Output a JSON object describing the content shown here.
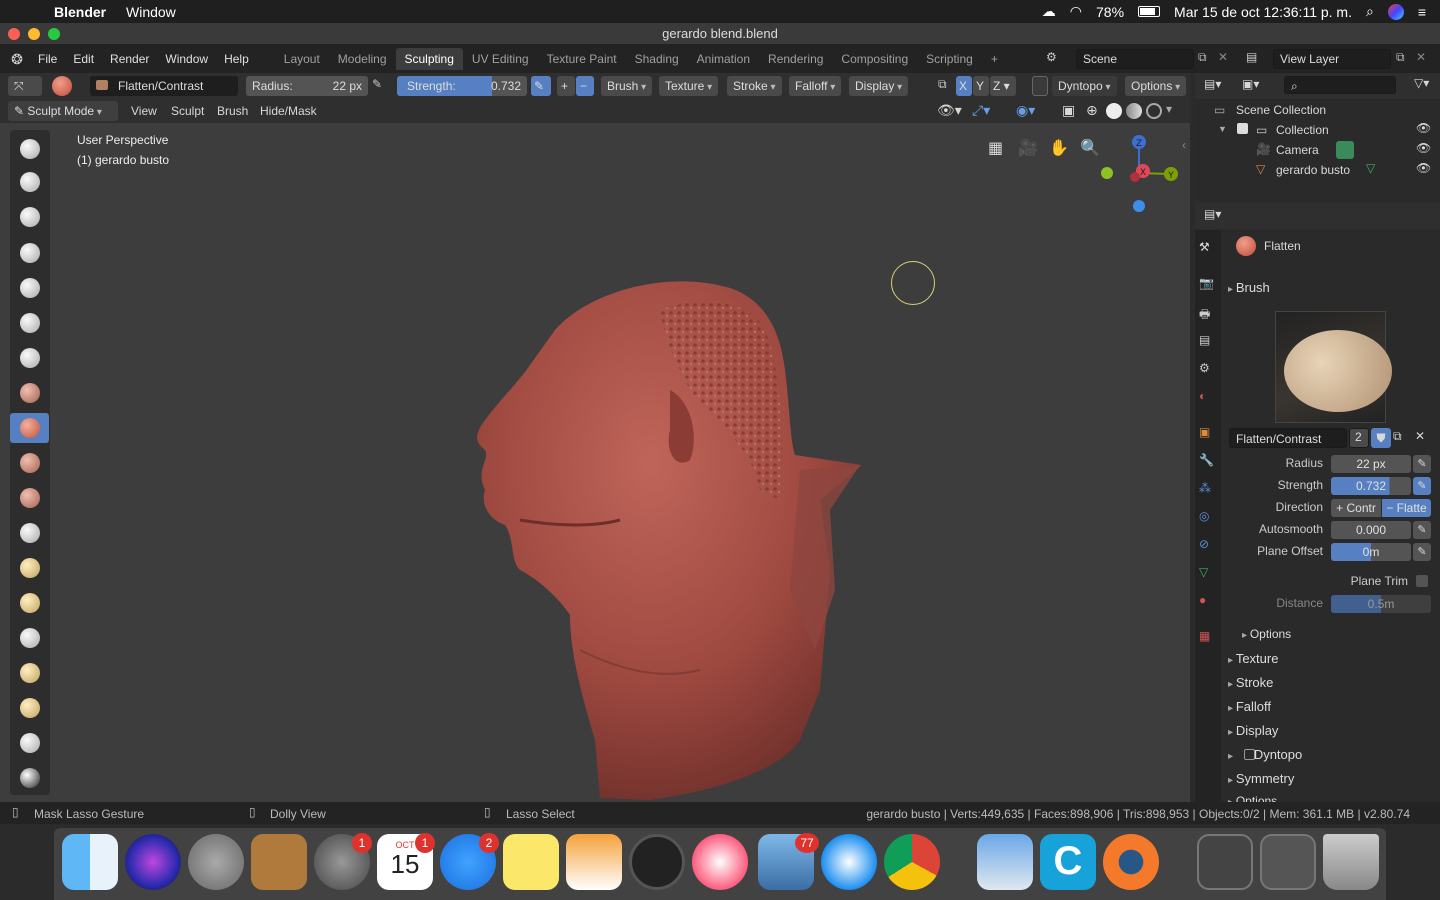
{
  "macbar": {
    "app": "Blender",
    "menu_window": "Window",
    "battery": "78%",
    "datetime": "Mar 15 de oct  12:36:11 p. m."
  },
  "window": {
    "title": "gerardo blend.blend"
  },
  "menu": [
    "File",
    "Edit",
    "Render",
    "Window",
    "Help"
  ],
  "workspaces": [
    "Layout",
    "Modeling",
    "Sculpting",
    "UV Editing",
    "Texture Paint",
    "Shading",
    "Animation",
    "Rendering",
    "Compositing",
    "Scripting"
  ],
  "scene": {
    "label": "Scene",
    "view_layer": "View Layer"
  },
  "tool_header": {
    "brush_name": "Flatten/Contrast",
    "radius_label": "Radius:",
    "radius_value": "22 px",
    "strength_label": "Strength:",
    "strength_value": "0.732",
    "plus": "+",
    "minus": "−",
    "brush": "Brush",
    "texture": "Texture",
    "stroke": "Stroke",
    "falloff": "Falloff",
    "display": "Display",
    "x": "X",
    "y": "Y",
    "z": "Z",
    "dyntopo": "Dyntopo",
    "options": "Options"
  },
  "mode_header": {
    "mode": "Sculpt Mode",
    "view": "View",
    "sculpt": "Sculpt",
    "brush": "Brush",
    "hide_mask": "Hide/Mask"
  },
  "viewport": {
    "perspective": "User Perspective",
    "object": "(1) gerardo busto"
  },
  "gizmo": {
    "z": "Z",
    "x": "X",
    "y": "Y"
  },
  "outliner": {
    "root": "Scene Collection",
    "collection": "Collection",
    "camera": "Camera",
    "object": "gerardo busto"
  },
  "properties": {
    "brush_title": "Flatten",
    "brush_section": "Brush",
    "brush_name": "Flatten/Contrast",
    "brush_users": "2",
    "radius_label": "Radius",
    "radius": "22 px",
    "strength_label": "Strength",
    "strength": "0.732",
    "direction_label": "Direction",
    "dir_contrast": "+ Contr",
    "dir_flatten": "− Flatte",
    "autosmooth_label": "Autosmooth",
    "autosmooth": "0.000",
    "plane_offset_label": "Plane Offset",
    "plane_offset": "0m",
    "plane_trim_label": "Plane Trim",
    "distance_label": "Distance",
    "distance": "0.5m",
    "options_sub": "Options",
    "sections": [
      "Texture",
      "Stroke",
      "Falloff",
      "Display",
      "Dyntopo",
      "Symmetry",
      "Options"
    ]
  },
  "status": {
    "left": "Mask Lasso Gesture",
    "mid": "Dolly View",
    "right": "Lasso Select",
    "stats": "gerardo busto | Verts:449,635 | Faces:898,906 | Tris:898,953 | Objects:0/2 | Mem: 361.1 MB | v2.80.74"
  },
  "dock": {
    "badge_sysprefs": "1",
    "calendar_month": "OCT",
    "calendar_day": "15",
    "badge_calendar": "1",
    "badge_appstore": "2",
    "badge_mail": "77"
  },
  "colors": {
    "accent": "#5680c2",
    "mesh": "#a04a42",
    "viewport_bg": "#3d3d3d"
  }
}
